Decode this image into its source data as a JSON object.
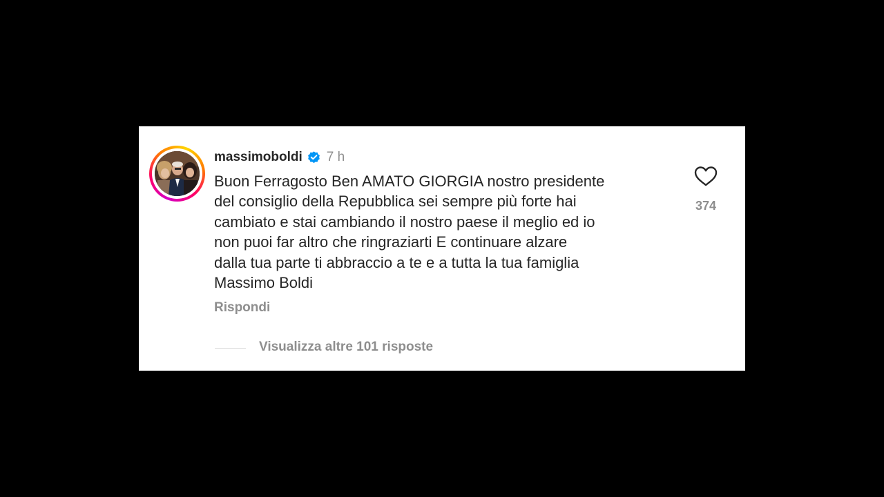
{
  "comment": {
    "username": "massimoboldi",
    "time": "7 h",
    "text": "Buon Ferragosto Ben AMATO GIORGIA nostro presidente\ndel consiglio della Repubblica sei sempre più forte hai\ncambiato e stai cambiando il nostro paese il meglio ed io\nnon puoi far altro che ringraziarti E continuare alzare\ndalla tua parte ti abbraccio a te e a tutta la tua famiglia\nMassimo Boldi",
    "reply_label": "Rispondi",
    "like_count": "374",
    "view_replies_label": "Visualizza altre 101 risposte"
  },
  "icons": {
    "verified": "verified-badge-icon",
    "like": "heart-outline-icon"
  },
  "colors": {
    "text": "#262626",
    "secondary": "#8e8e8e",
    "verified": "#0095f6",
    "background": "#000000",
    "card": "#ffffff"
  }
}
